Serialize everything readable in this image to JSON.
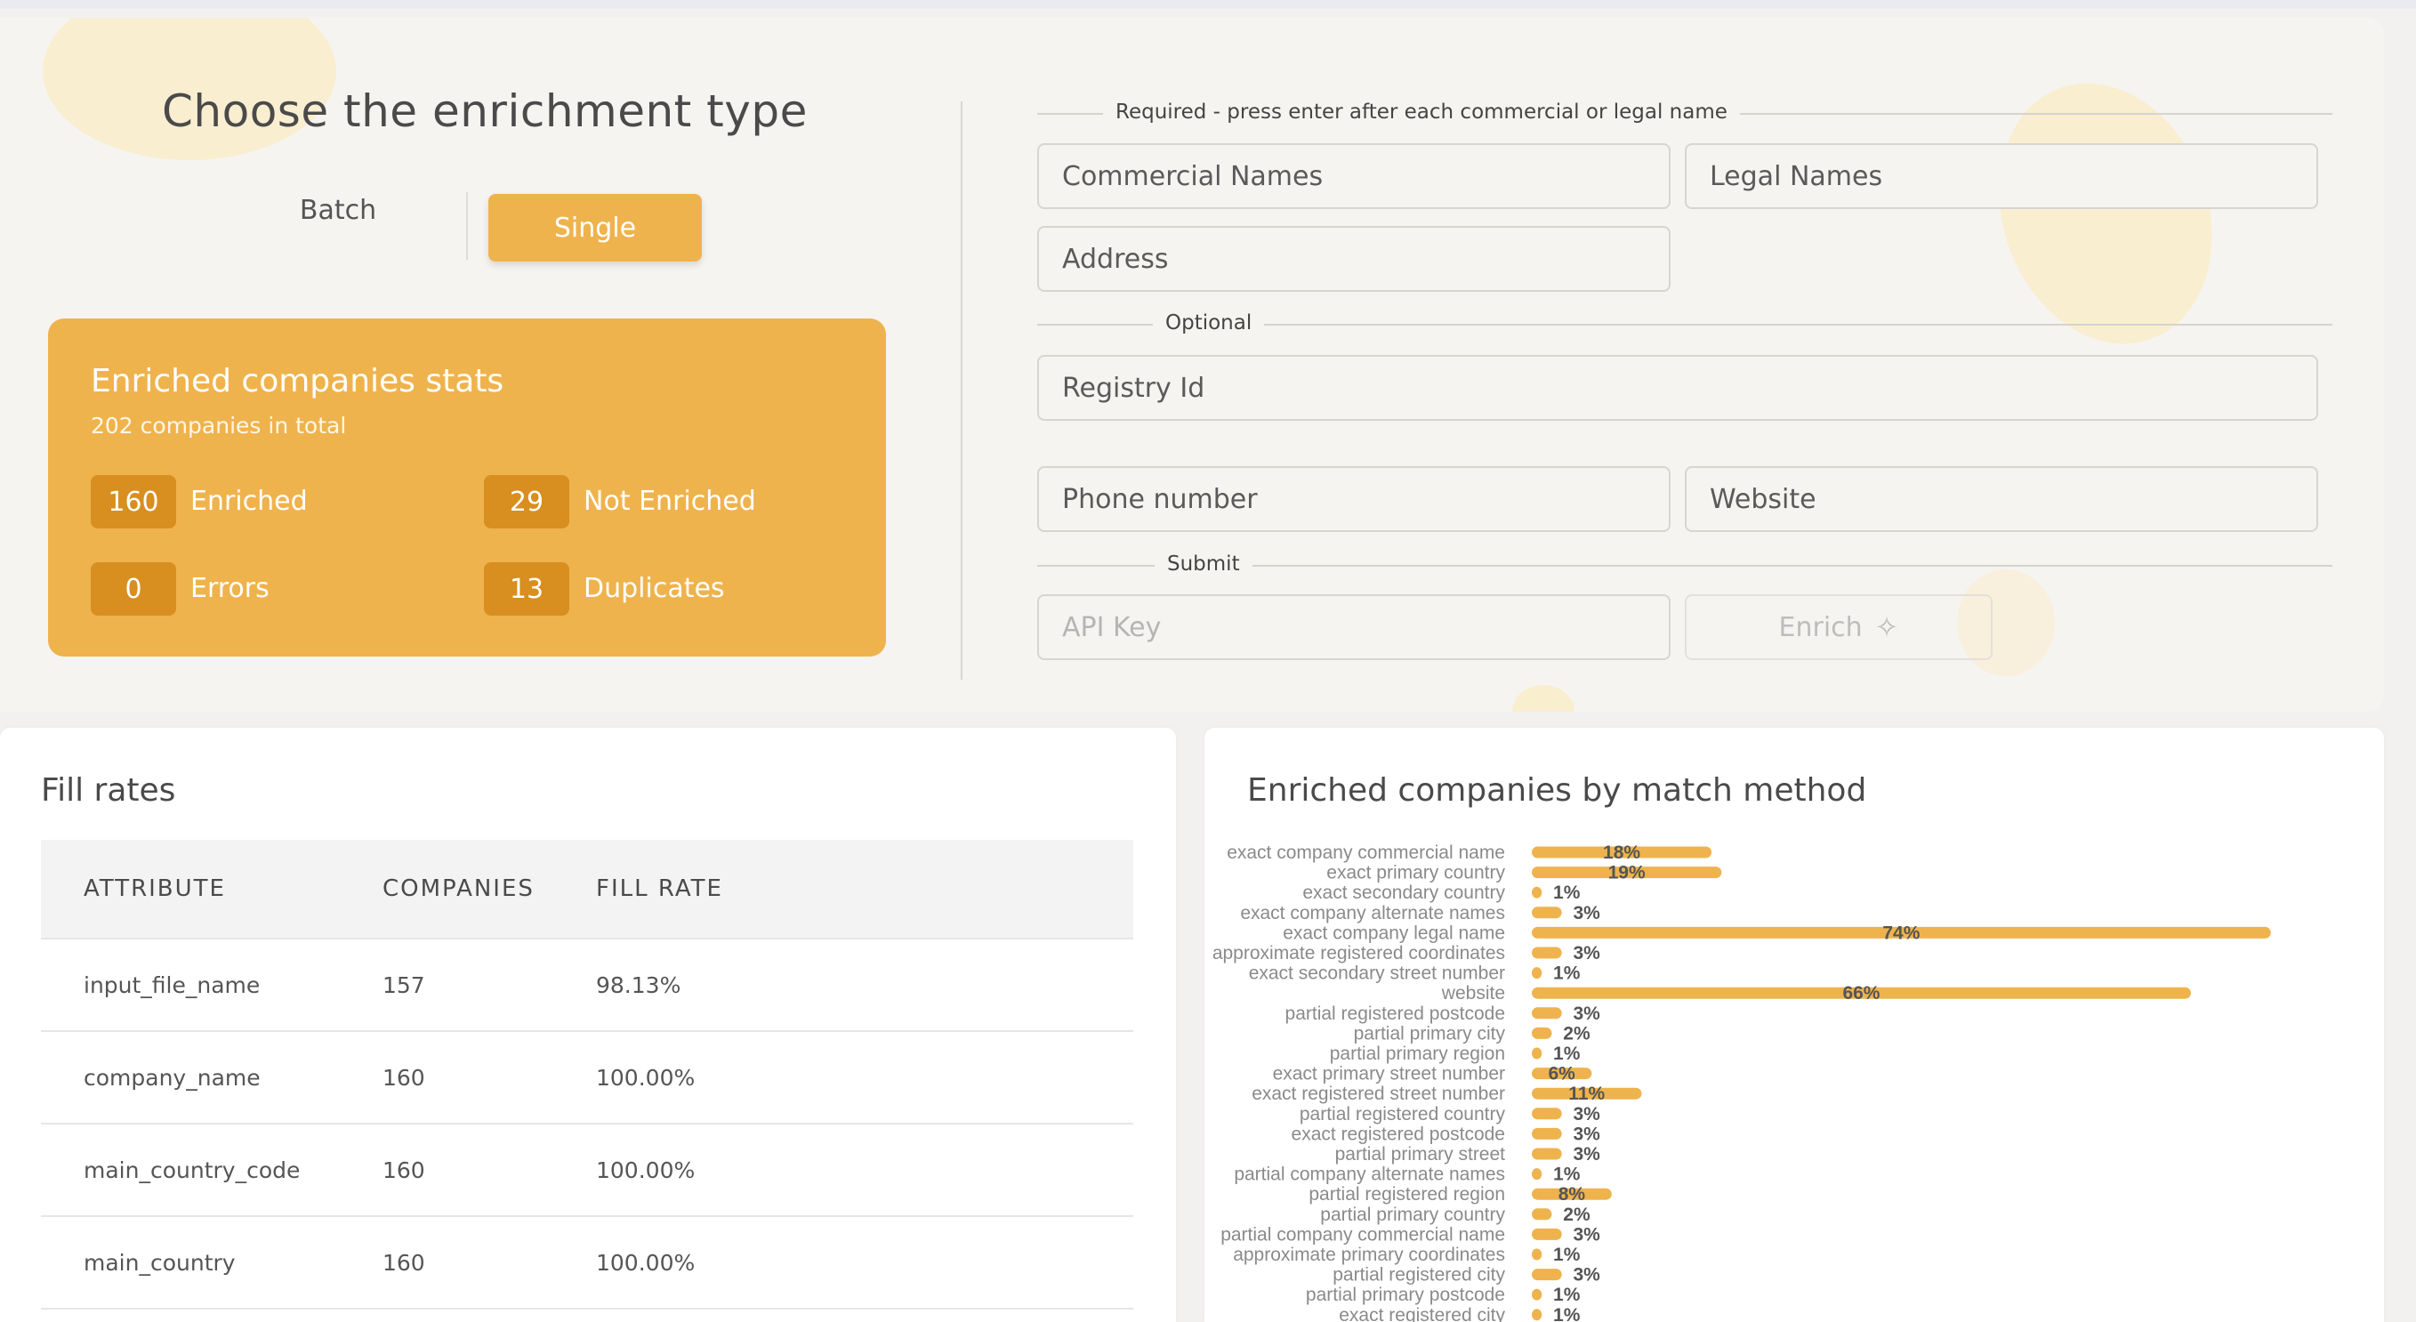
{
  "enrichment": {
    "title": "Choose the enrichment type",
    "toggle": {
      "batch_label": "Batch",
      "single_label": "Single",
      "selected": "Single"
    }
  },
  "stats": {
    "title": "Enriched companies stats",
    "subtitle": "202 companies in total",
    "items": [
      {
        "value": "160",
        "label": "Enriched"
      },
      {
        "value": "29",
        "label": "Not Enriched"
      },
      {
        "value": "0",
        "label": "Errors"
      },
      {
        "value": "13",
        "label": "Duplicates"
      }
    ]
  },
  "form": {
    "required_label": "Required - press enter after each commercial or legal name",
    "optional_label": "Optional",
    "submit_label": "Submit",
    "commercial_names": "Commercial Names",
    "legal_names": "Legal Names",
    "address": "Address",
    "registry_id": "Registry Id",
    "phone_number": "Phone number",
    "website": "Website",
    "api_key_placeholder": "API Key",
    "enrich_label": "Enrich"
  },
  "fill_rates": {
    "title": "Fill rates",
    "columns": [
      "ATTRIBUTE",
      "COMPANIES",
      "FILL RATE"
    ],
    "rows": [
      [
        "input_file_name",
        "157",
        "98.13%"
      ],
      [
        "company_name",
        "160",
        "100.00%"
      ],
      [
        "main_country_code",
        "160",
        "100.00%"
      ],
      [
        "main_country",
        "160",
        "100.00%"
      ]
    ]
  },
  "match_method": {
    "title": "Enriched companies by match method"
  },
  "chart_data": {
    "type": "bar",
    "orientation": "horizontal",
    "bar_color": "#efb34d",
    "categories": [
      "exact company commercial name",
      "exact primary country",
      "exact secondary country",
      "exact company alternate names",
      "exact company legal name",
      "approximate registered coordinates",
      "exact secondary street number",
      "website",
      "partial registered postcode",
      "partial primary city",
      "partial primary region",
      "exact primary street number",
      "exact registered street number",
      "partial registered country",
      "exact registered postcode",
      "partial primary street",
      "partial company alternate names",
      "partial registered region",
      "partial primary country",
      "partial company commercial name",
      "approximate primary coordinates",
      "partial registered city",
      "partial primary postcode",
      "exact registered city"
    ],
    "values": [
      18,
      19,
      1,
      3,
      74,
      3,
      1,
      66,
      3,
      2,
      1,
      6,
      11,
      3,
      3,
      3,
      1,
      8,
      2,
      3,
      1,
      3,
      1,
      1
    ],
    "value_suffix": "%",
    "xlim": [
      0,
      75
    ]
  }
}
